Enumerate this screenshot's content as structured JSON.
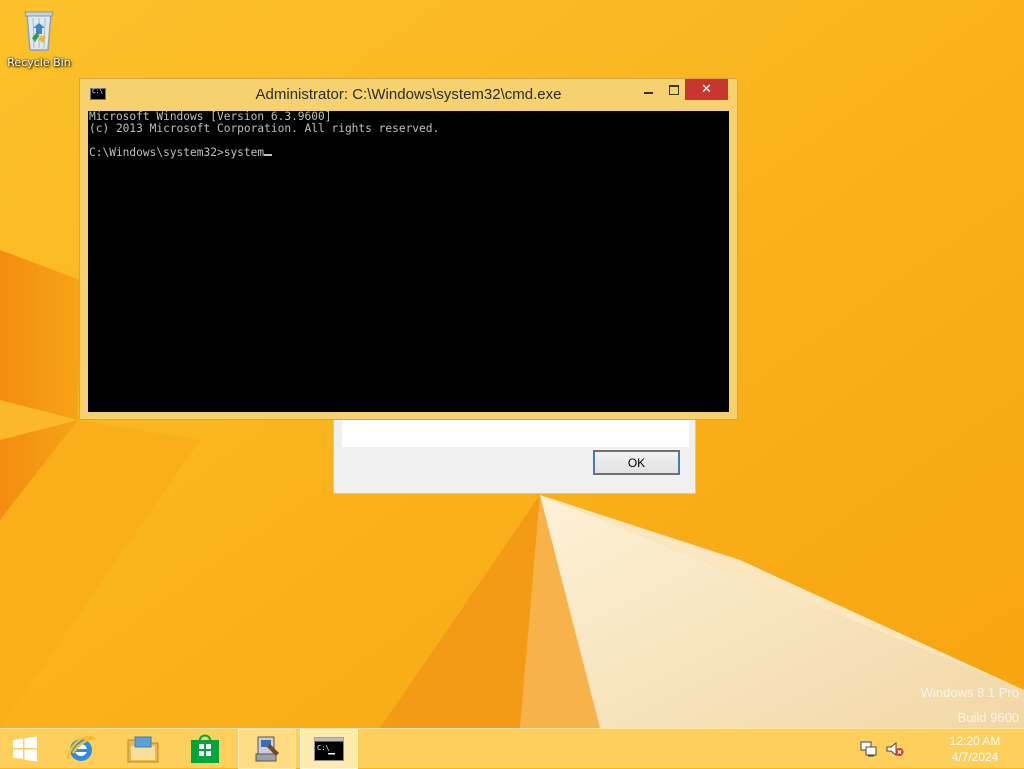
{
  "desktop": {
    "icons": [
      {
        "label": "Recycle Bin"
      }
    ],
    "watermark": {
      "line1": "Windows 8.1 Pro",
      "line2": "Build 9600"
    }
  },
  "console_window": {
    "title": "Administrator: C:\\Windows\\system32\\cmd.exe",
    "lines": [
      "Microsoft Windows [Version 6.3.9600]",
      "(c) 2013 Microsoft Corporation. All rights reserved.",
      "",
      "C:\\Windows\\system32>system"
    ],
    "title_buttons": [
      "minimize",
      "maximize",
      "close"
    ]
  },
  "message_box": {
    "ok_label": "OK"
  },
  "taskbar": {
    "start_icon": "windows-logo-icon",
    "pinned": [
      {
        "name": "internet-explorer",
        "icon": "internet-explorer-icon"
      },
      {
        "name": "file-explorer",
        "icon": "folder-icon"
      },
      {
        "name": "store",
        "icon": "store-icon"
      },
      {
        "name": "setup-program",
        "icon": "setup-icon",
        "state": "running"
      },
      {
        "name": "command-prompt",
        "icon": "cmd-icon",
        "state": "active"
      }
    ],
    "tray": {
      "network_icon": "network-icon",
      "volume_icon": "volume-muted-icon"
    },
    "clock": {
      "time": "12:20 AM",
      "date": "4/7/2024"
    }
  },
  "colors": {
    "wallpaper_base": "#fbb517",
    "window_frame": "#f6d170",
    "close_button": "#c7372f",
    "console_background": "#000000",
    "console_text": "#c0c0c0"
  }
}
